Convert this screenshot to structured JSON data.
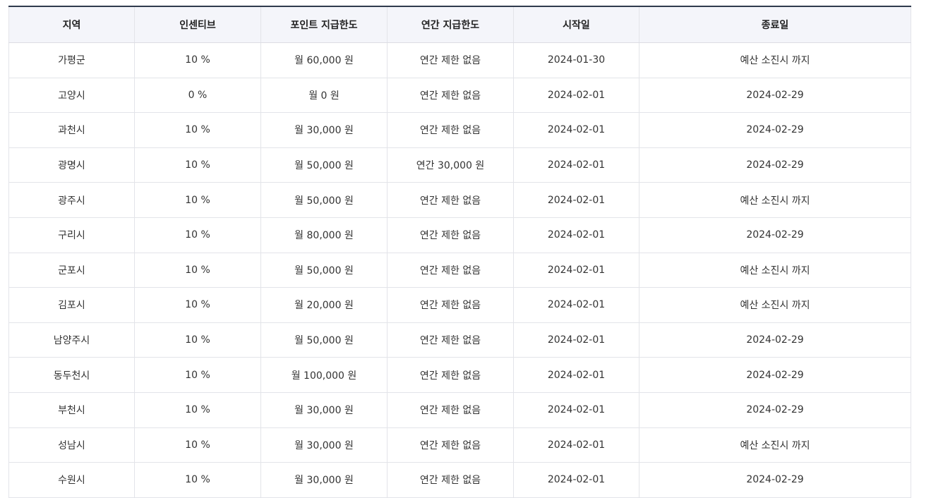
{
  "table": {
    "headers": [
      "지역",
      "인센티브",
      "포인트 지급한도",
      "연간 지급한도",
      "시작일",
      "종료일"
    ],
    "rows": [
      [
        "가평군",
        "10 %",
        "월 60,000 원",
        "연간 제한 없음",
        "2024-01-30",
        "예산 소진시 까지"
      ],
      [
        "고양시",
        "0 %",
        "월 0 원",
        "연간 제한 없음",
        "2024-02-01",
        "2024-02-29"
      ],
      [
        "과천시",
        "10 %",
        "월 30,000 원",
        "연간 제한 없음",
        "2024-02-01",
        "2024-02-29"
      ],
      [
        "광명시",
        "10 %",
        "월 50,000 원",
        "연간 30,000 원",
        "2024-02-01",
        "2024-02-29"
      ],
      [
        "광주시",
        "10 %",
        "월 50,000 원",
        "연간 제한 없음",
        "2024-02-01",
        "예산 소진시 까지"
      ],
      [
        "구리시",
        "10 %",
        "월 80,000 원",
        "연간 제한 없음",
        "2024-02-01",
        "2024-02-29"
      ],
      [
        "군포시",
        "10 %",
        "월 50,000 원",
        "연간 제한 없음",
        "2024-02-01",
        "예산 소진시 까지"
      ],
      [
        "김포시",
        "10 %",
        "월 20,000 원",
        "연간 제한 없음",
        "2024-02-01",
        "예산 소진시 까지"
      ],
      [
        "남양주시",
        "10 %",
        "월 50,000 원",
        "연간 제한 없음",
        "2024-02-01",
        "2024-02-29"
      ],
      [
        "동두천시",
        "10 %",
        "월 100,000 원",
        "연간 제한 없음",
        "2024-02-01",
        "2024-02-29"
      ],
      [
        "부천시",
        "10 %",
        "월 30,000 원",
        "연간 제한 없음",
        "2024-02-01",
        "2024-02-29"
      ],
      [
        "성남시",
        "10 %",
        "월 30,000 원",
        "연간 제한 없음",
        "2024-02-01",
        "예산 소진시 까지"
      ],
      [
        "수원시",
        "10 %",
        "월 30,000 원",
        "연간 제한 없음",
        "2024-02-01",
        "2024-02-29"
      ]
    ]
  }
}
